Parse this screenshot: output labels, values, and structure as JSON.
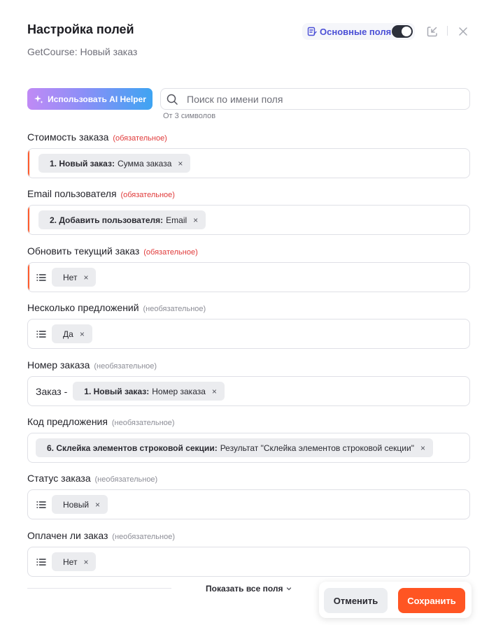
{
  "header": {
    "title": "Настройка полей",
    "subtitle": "GetCourse: Новый заказ",
    "basic_fields_label": "Основные поля",
    "basic_fields_enabled": true,
    "icons": [
      "list-edit-icon",
      "collapse-arrow-icon",
      "close-icon"
    ]
  },
  "toolbar": {
    "ai_helper_label": "Использовать AI Helper",
    "search_placeholder": "Поиск по имени поля",
    "search_value": "",
    "search_hint": "От 3 символов"
  },
  "fields": [
    {
      "label": "Стоимость заказа",
      "tag": "(обязательное)",
      "required": true,
      "list_icon": false,
      "prefix": "",
      "chip_source": "1. Новый заказ:",
      "chip_value": "Сумма заказа"
    },
    {
      "label": "Email пользователя",
      "tag": "(обязательное)",
      "required": true,
      "list_icon": false,
      "prefix": "",
      "chip_source": "2. Добавить пользователя:",
      "chip_value": "Email"
    },
    {
      "label": "Обновить текущий заказ",
      "tag": "(обязательное)",
      "required": true,
      "list_icon": true,
      "prefix": "",
      "chip_source": "",
      "chip_value": "Нет"
    },
    {
      "label": "Несколько предложений",
      "tag": "(необязательное)",
      "required": false,
      "list_icon": true,
      "prefix": "",
      "chip_source": "",
      "chip_value": "Да"
    },
    {
      "label": "Номер заказа",
      "tag": "(необязательное)",
      "required": false,
      "list_icon": false,
      "prefix": "Заказ -",
      "chip_source": "1. Новый заказ:",
      "chip_value": "Номер заказа"
    },
    {
      "label": "Код предложения",
      "tag": "(необязательное)",
      "required": false,
      "list_icon": false,
      "prefix": "",
      "chip_source": "6. Склейка элементов строковой секции:",
      "chip_value": "Результат \"Склейка элементов строковой секции\""
    },
    {
      "label": "Статус заказа",
      "tag": "(необязательное)",
      "required": false,
      "list_icon": true,
      "prefix": "",
      "chip_source": "",
      "chip_value": "Новый"
    },
    {
      "label": "Оплачен ли заказ",
      "tag": "(необязательное)",
      "required": false,
      "list_icon": true,
      "prefix": "",
      "chip_source": "",
      "chip_value": "Нет"
    }
  ],
  "footer": {
    "show_all_label": "Показать все поля",
    "cancel_label": "Отменить",
    "save_label": "Сохранить"
  },
  "colors": {
    "accent": "#ff5523",
    "required_tag": "#e03a3a",
    "basic_fields_text": "#4b4fd6",
    "toggle_on": "#2b2f3a"
  }
}
